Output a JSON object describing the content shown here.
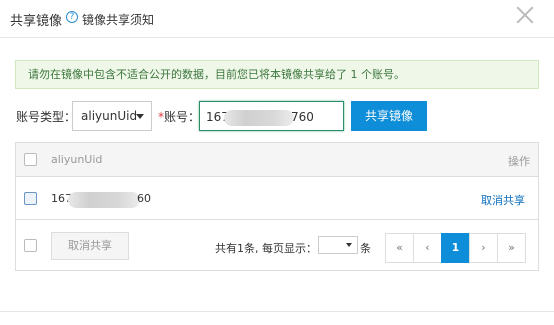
{
  "dialog": {
    "title": "共享镜像",
    "help_icon": "?",
    "help_link": "镜像共享须知"
  },
  "notice": "请勿在镜像中包含不适合公开的数据，目前您已将本镜像共享给了 1 个账号。",
  "form": {
    "type_label": "账号类型：",
    "type_value": "aliyunUid",
    "required_mark": "*",
    "account_label": "账号：",
    "account_value_prefix": "167",
    "account_value_suffix": "760",
    "share_button": "共享镜像"
  },
  "table": {
    "headers": {
      "col_account": "aliyunUid",
      "col_op": "操作"
    },
    "rows": [
      {
        "account_prefix": "167",
        "account_suffix": "60",
        "action": "取消共享"
      }
    ],
    "footer": {
      "unshare_button": "取消共享",
      "total_text": "共有1条, 每页显示：",
      "per_page_unit": "条"
    }
  },
  "pagination": {
    "first": "«",
    "prev": "‹",
    "current": "1",
    "next": "›",
    "last": "»"
  },
  "colors": {
    "primary": "#0e8ed9",
    "notice_bg": "#eff8e8",
    "notice_text": "#3c763d",
    "required": "#e4393c",
    "link": "#0e6fbe"
  }
}
